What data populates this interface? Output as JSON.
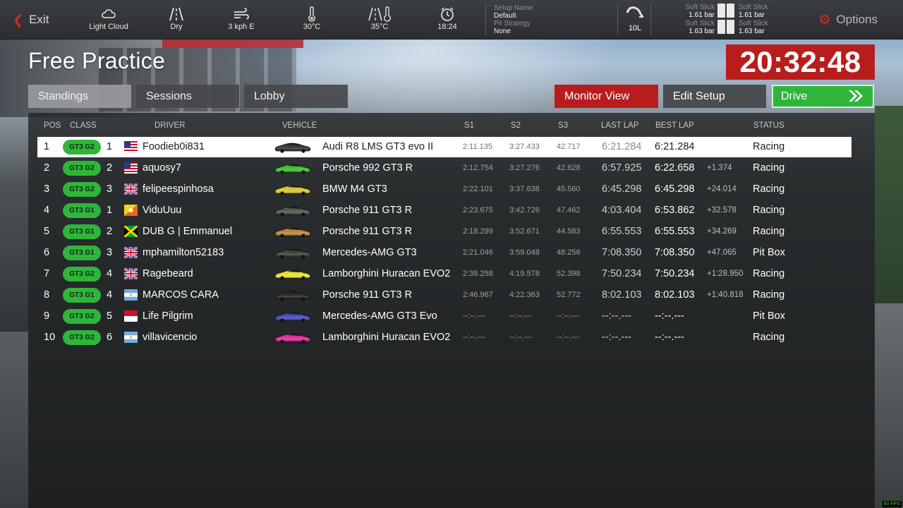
{
  "topbar": {
    "exit_label": "Exit",
    "weather": [
      {
        "icon": "cloud-icon",
        "label": "Light Cloud"
      },
      {
        "icon": "road-icon",
        "label": "Dry"
      },
      {
        "icon": "wind-icon",
        "label": "3 kph E"
      },
      {
        "icon": "thermometer-icon",
        "label": "30°C"
      },
      {
        "icon": "track-temp-icon",
        "label": "35°C"
      },
      {
        "icon": "alarm-clock-icon",
        "label": "18:24"
      }
    ],
    "setup_name_label": "Setup Name",
    "setup_name_value": "Default",
    "pit_strategy_label": "Pit Strategy",
    "pit_strategy_value": "None",
    "fuel_label": "10L",
    "tyres": {
      "fl_label": "Soft Slick",
      "fl_value": "1.61 bar",
      "fr_label": "Soft Slick",
      "fr_value": "1.61 bar",
      "rl_label": "Soft Slick",
      "rl_value": "1.63 bar",
      "rr_label": "Soft Slick",
      "rr_value": "1.63 bar"
    },
    "options_label": "Options"
  },
  "session": {
    "title": "Free Practice",
    "time_remaining": "20:32:48"
  },
  "tabs": [
    "Standings",
    "Sessions",
    "Lobby"
  ],
  "actions": {
    "monitor_view": "Monitor View",
    "edit_setup": "Edit Setup",
    "drive": "Drive"
  },
  "columns": {
    "pos": "POS",
    "class": "CLASS",
    "driver": "DRIVER",
    "vehicle": "VEHICLE",
    "s1": "S1",
    "s2": "S2",
    "s3": "S3",
    "last_lap": "LAST LAP",
    "best_lap": "BEST LAP",
    "status": "STATUS"
  },
  "colors": {
    "accent_red": "#b81d1d",
    "class_green": "#2fb53a",
    "drive_green": "#2fb53a"
  },
  "standings": [
    {
      "pos": "1",
      "class": "GT3 G2",
      "class_pos": "1",
      "flag": "us",
      "driver": "Foodieb0i831",
      "car_color": "#3a3a40",
      "vehicle": "Audi R8 LMS GT3 evo II",
      "s1": "2:11.135",
      "s2": "3:27.433",
      "s3": "42.717",
      "last": "6:21.284",
      "best": "6:21.284",
      "gap": "",
      "status": "Racing"
    },
    {
      "pos": "2",
      "class": "GT3 G2",
      "class_pos": "2",
      "flag": "us",
      "driver": "aquosy7",
      "car_color": "#3fbf2f",
      "vehicle": "Porsche 992 GT3 R",
      "s1": "2:12.754",
      "s2": "3:27.276",
      "s3": "42.628",
      "last": "6:57.925",
      "best": "6:22.658",
      "gap": "+1.374",
      "status": "Racing"
    },
    {
      "pos": "3",
      "class": "GT3 G2",
      "class_pos": "3",
      "flag": "gb",
      "driver": "felipeespinhosa",
      "car_color": "#d8c62a",
      "vehicle": "BMW M4 GT3",
      "s1": "2:22.101",
      "s2": "3:37.638",
      "s3": "45.560",
      "last": "6:45.298",
      "best": "6:45.298",
      "gap": "+24.014",
      "status": "Racing"
    },
    {
      "pos": "4",
      "class": "GT3 G1",
      "class_pos": "1",
      "flag": "bt",
      "driver": "ViduUuu",
      "car_color": "#555a50",
      "vehicle": "Porsche 911 GT3 R",
      "s1": "2:23.675",
      "s2": "3:42.726",
      "s3": "47.462",
      "last": "4:03.404",
      "best": "6:53.862",
      "gap": "+32.578",
      "status": "Racing"
    },
    {
      "pos": "5",
      "class": "GT3 G1",
      "class_pos": "2",
      "flag": "jm",
      "driver": "DUB G | Emmanuel",
      "car_color": "#b8873a",
      "vehicle": "Porsche 911 GT3 R",
      "s1": "2:18.299",
      "s2": "3:52.671",
      "s3": "44.583",
      "last": "6:55.553",
      "best": "6:55.553",
      "gap": "+34.269",
      "status": "Racing"
    },
    {
      "pos": "6",
      "class": "GT3 G1",
      "class_pos": "3",
      "flag": "gb",
      "driver": "mphamilton52183",
      "car_color": "#3a4a3a",
      "vehicle": "Mercedes-AMG GT3",
      "s1": "2:21.046",
      "s2": "3:59.048",
      "s3": "48.256",
      "last": "7:08.350",
      "best": "7:08.350",
      "gap": "+47.065",
      "status": "Pit Box"
    },
    {
      "pos": "7",
      "class": "GT3 G2",
      "class_pos": "4",
      "flag": "gb",
      "driver": "Ragebeard",
      "car_color": "#e3e030",
      "vehicle": "Lamborghini Huracan EVO2",
      "s1": "2:38.258",
      "s2": "4:19.578",
      "s3": "52.398",
      "last": "7:50.234",
      "best": "7:50.234",
      "gap": "+1:28.950",
      "status": "Racing"
    },
    {
      "pos": "8",
      "class": "GT3 G1",
      "class_pos": "4",
      "flag": "ar",
      "driver": "MARCOS CARA",
      "car_color": "#2d2d30",
      "vehicle": "Porsche 911 GT3 R",
      "s1": "2:46.967",
      "s2": "4:22.363",
      "s3": "52.772",
      "last": "8:02.103",
      "best": "8:02.103",
      "gap": "+1:40.818",
      "status": "Racing"
    },
    {
      "pos": "9",
      "class": "GT3 G2",
      "class_pos": "5",
      "flag": "mc",
      "driver": "Life Pilgrim",
      "car_color": "#4a4fb8",
      "vehicle": "Mercedes-AMG GT3 Evo",
      "s1": "--:--.---",
      "s2": "--:--.---",
      "s3": "--:--.---",
      "last": "--:--.---",
      "best": "--:--.---",
      "gap": "",
      "status": "Pit Box"
    },
    {
      "pos": "10",
      "class": "GT3 G2",
      "class_pos": "6",
      "flag": "ar",
      "driver": "villavicencio",
      "car_color": "#e02f9c",
      "vehicle": "Lamborghini Huracan EVO2",
      "s1": "--:--.---",
      "s2": "--:--.---",
      "s3": "--:--.---",
      "last": "--:--.---",
      "best": "--:--.---",
      "gap": "",
      "status": "Racing"
    }
  ]
}
